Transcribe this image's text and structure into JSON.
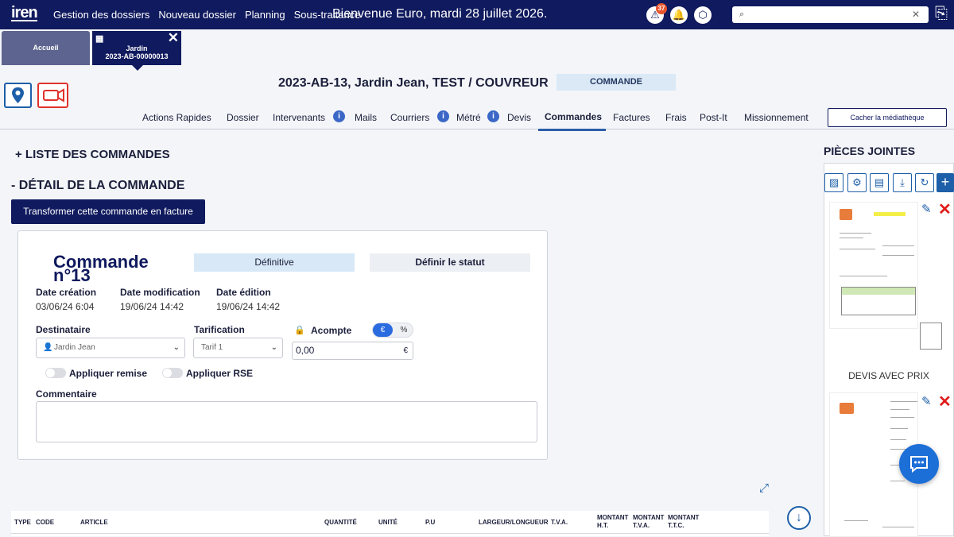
{
  "topbar": {
    "logo": "iren",
    "nav": [
      "Gestion des dossiers",
      "Nouveau dossier",
      "Planning",
      "Sous-traitance"
    ],
    "welcome": "Bienvenue Euro, mardi 28 juillet 2026.",
    "alert_count": "37",
    "search_placeholder": ""
  },
  "tabs": {
    "home": "Accueil",
    "dossier_line1": "Jardin",
    "dossier_line2": "2023-AB-00000013"
  },
  "header": {
    "title": "2023-AB-13, Jardin Jean, TEST / COUVREUR",
    "chip": "COMMANDE",
    "media_button": "Cacher la médiathèque"
  },
  "subtabs": [
    "Actions Rapides",
    "Dossier",
    "Intervenants",
    "Mails",
    "Courriers",
    "Métré",
    "Devis",
    "Commandes",
    "Factures",
    "Frais",
    "Post-It",
    "Missionnement"
  ],
  "active_subtab": "Commandes",
  "sections": {
    "list": "+ LISTE DES COMMANDES",
    "detail": "- DÉTAIL DE LA COMMANDE",
    "transform_button": "Transformer cette commande en facture"
  },
  "order": {
    "title": "Commande n°13",
    "status_current": "Définitive",
    "status_button": "Définir le statut",
    "date_creation_label": "Date création",
    "date_creation": "03/06/24 6:04",
    "date_modification_label": "Date modification",
    "date_modification": "19/06/24 14:42",
    "date_edition_label": "Date édition",
    "date_edition": "19/06/24 14:42",
    "destinataire_label": "Destinataire",
    "destinataire": "Jardin Jean",
    "tarification_label": "Tarification",
    "tarification": "Tarif 1",
    "acompte_label": "Acompte",
    "acompte_mode_euro": "€",
    "acompte_mode_percent": "%",
    "acompte_value": "0,00",
    "acompte_unit": "€",
    "remise_label": "Appliquer remise",
    "rse_label": "Appliquer RSE",
    "comment_label": "Commentaire"
  },
  "table": {
    "columns": [
      "TYPE",
      "CODE",
      "ARTICLE",
      "QUANTITÉ",
      "UNITÉ",
      "P.U",
      "LARGEUR/LONGUEUR",
      "T.V.A.",
      "MONTANT H.T.",
      "MONTANT T.V.A.",
      "MONTANT T.T.C."
    ]
  },
  "attachments": {
    "title": "PIÈCES JOINTES",
    "items": [
      {
        "caption": "DEVIS AVEC PRIX"
      },
      {
        "caption": ""
      }
    ]
  },
  "colors": {
    "topbar": "#101a5e",
    "accent": "#1d5fa8",
    "chip": "#dbe9f7",
    "delete": "#e01b1b"
  }
}
